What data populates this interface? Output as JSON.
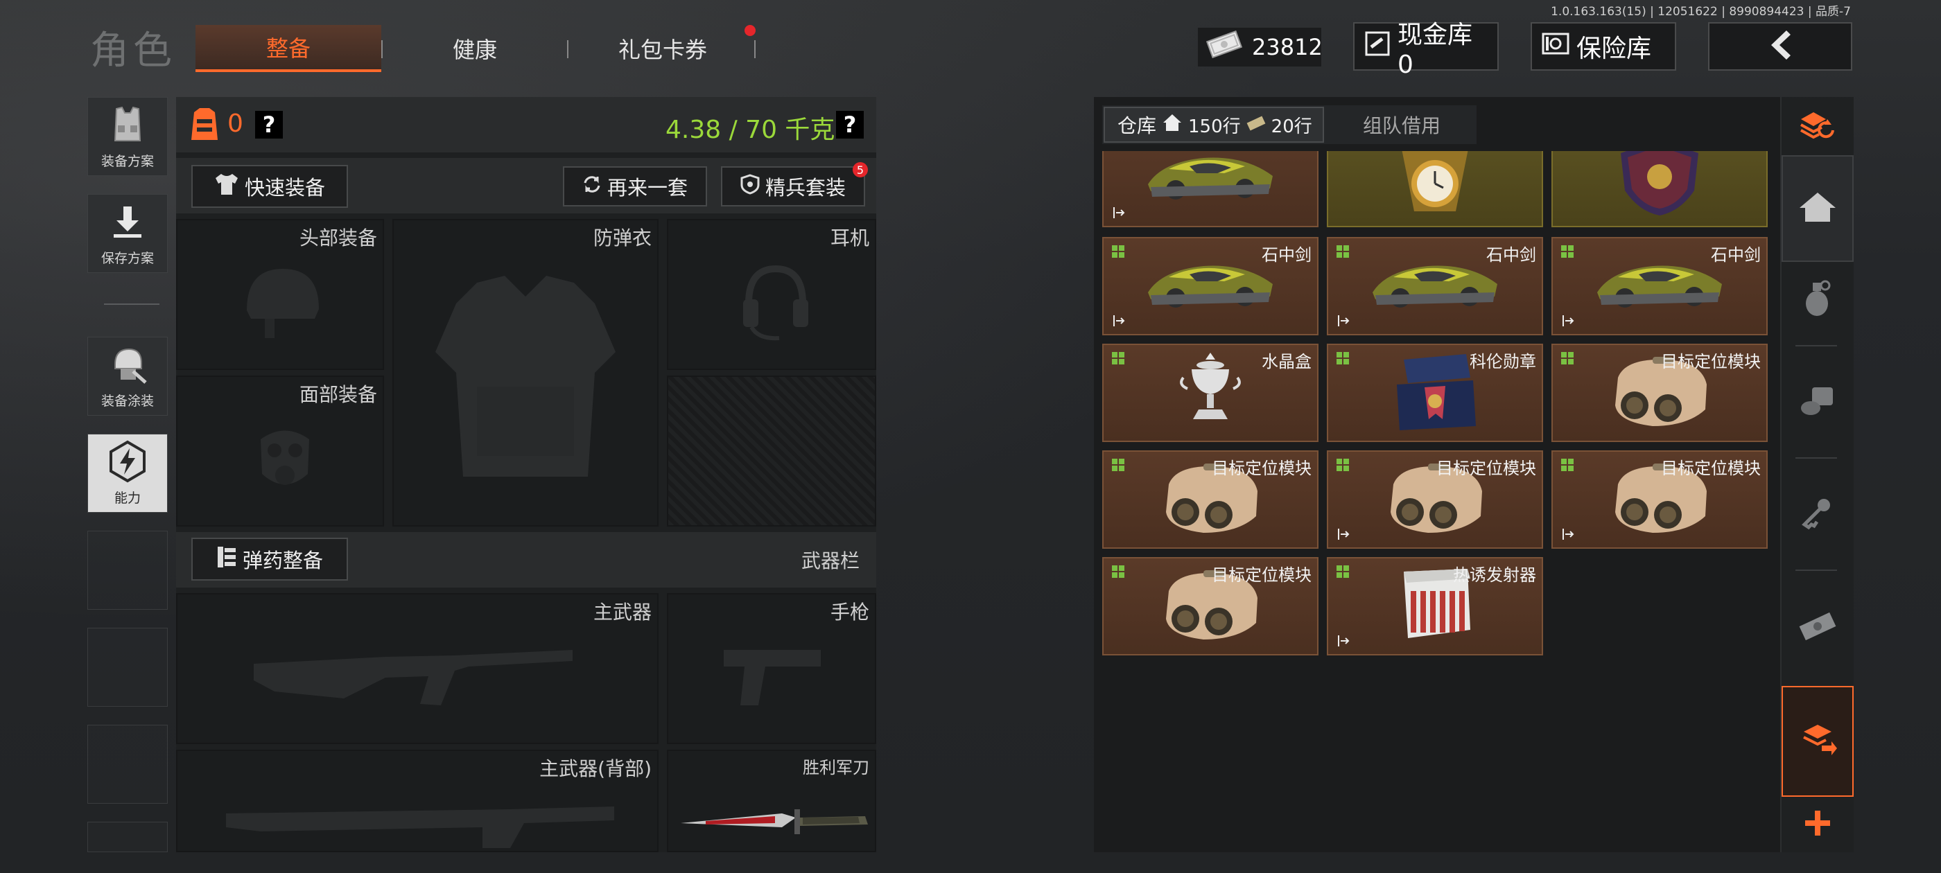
{
  "version_info": "1.0.163.163(15) | 12051622 | 8990894423 | 品质-7",
  "header": {
    "title": "角色",
    "tabs": [
      {
        "label": "整备",
        "active": true
      },
      {
        "label": "健康",
        "active": false
      },
      {
        "label": "礼包卡券",
        "active": false,
        "notification": true
      }
    ],
    "cash_amount": "23812",
    "cash_vault_label": "现金库 0",
    "safe_label": "保险库",
    "back_icon": "chevron-left-icon"
  },
  "left_sidebar": {
    "items": [
      {
        "label": "装备方案",
        "icon": "vest-icon"
      },
      {
        "label": "保存方案",
        "icon": "download-icon"
      },
      {
        "label": "装备涂装",
        "icon": "helmet-paint-icon"
      },
      {
        "label": "能力",
        "icon": "lightning-hexagon-icon",
        "selected": true
      }
    ]
  },
  "loadout": {
    "backpack_count": "0",
    "help_mark": "?",
    "weight": "4.38 / 70 千克",
    "quick_equip_label": "快速装备",
    "reroll_label": "再来一套",
    "elite_set_label": "精兵套装",
    "elite_set_badge": "5",
    "slots": {
      "head": "头部装备",
      "armor": "防弹衣",
      "headset": "耳机",
      "face": "面部装备",
      "primary": "主武器",
      "pistol": "手枪",
      "primary_back": "主武器(背部)",
      "melee": "胜利军刀"
    },
    "ammo_label": "弹药整备",
    "weapon_bar_label": "武器栏"
  },
  "warehouse": {
    "tab_label": "仓库",
    "rows_label": "150行",
    "ticket_rows_label": "20行",
    "team_borrow_label": "组队借用",
    "items": [
      {
        "name": "",
        "kind": "car",
        "style": "brown"
      },
      {
        "name": "",
        "kind": "watch",
        "style": "gold"
      },
      {
        "name": "",
        "kind": "badge",
        "style": "gold"
      },
      {
        "name": "石中剑",
        "kind": "car",
        "style": "brown"
      },
      {
        "name": "石中剑",
        "kind": "car",
        "style": "brown"
      },
      {
        "name": "石中剑",
        "kind": "car",
        "style": "brown"
      },
      {
        "name": "水晶盒",
        "kind": "cup",
        "style": "brown"
      },
      {
        "name": "科伦勋章",
        "kind": "medal",
        "style": "brown"
      },
      {
        "name": "目标定位模块",
        "kind": "module",
        "style": "brown"
      },
      {
        "name": "目标定位模块",
        "kind": "module",
        "style": "brown"
      },
      {
        "name": "目标定位模块",
        "kind": "module",
        "style": "brown"
      },
      {
        "name": "目标定位模块",
        "kind": "module",
        "style": "brown"
      },
      {
        "name": "目标定位模块",
        "kind": "module",
        "style": "brown"
      },
      {
        "name": "热诱发射器",
        "kind": "launcher",
        "style": "brown"
      }
    ]
  },
  "right_sidebar": {
    "icons": [
      "sort-refresh-icon",
      "home-icon",
      "grenade-icon",
      "food-icon",
      "key-icon",
      "cash-icon",
      "transfer-icon",
      "plus-icon"
    ]
  },
  "colors": {
    "accent": "#ff6a2c",
    "weight_green": "#9bd93a",
    "item_brown": "#4a2f20",
    "item_gold": "#5c5322"
  }
}
